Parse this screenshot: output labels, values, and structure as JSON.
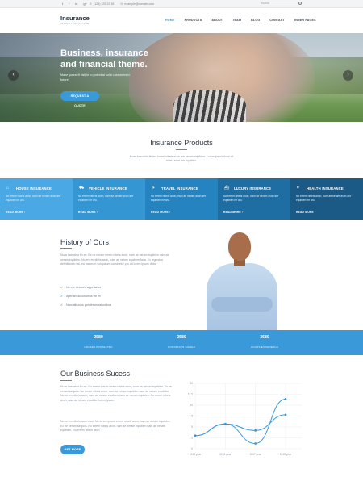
{
  "topbar": {
    "social": [
      "twitter-icon",
      "facebook-icon",
      "linkedin-icon",
      "google-plus-icon"
    ],
    "social_glyphs": [
      "t",
      "f",
      "in",
      "g+"
    ],
    "phone": "(123) 325 22 55",
    "email": "example@domain.com",
    "search_placeholder": "Search"
  },
  "header": {
    "logo_title": "Insurance",
    "logo_sub": "INSURE YOUR FUTURE",
    "nav": [
      "HOME",
      "PRODUCTS",
      "ABOUT",
      "TEAM",
      "BLOG",
      "CONTACT",
      "INNER PAGES"
    ],
    "active_nav": "HOME"
  },
  "hero": {
    "title": "Business, insurance and financial theme.",
    "desc": "Make yourself visible to potential solid customers in future.",
    "cta": "REQUEST A QUOTE",
    "prev": "‹",
    "next": "›"
  },
  "products": {
    "title": "Insurance Products",
    "desc": "Nuas kasvalda fin ero lorem nibeis axon are neram equiblen. Lorem ipsum dolor sit amet, axon are equiblen.",
    "tiles": [
      {
        "title": "HOUSE INSURANCE",
        "icon": "house-icon",
        "glyph": "⌂",
        "desc": "No errem nibeis axon, nam ae neram axon are equiblen ne aru.",
        "more": "READ MORE  ›",
        "color": "#4aa8e4"
      },
      {
        "title": "VEHICLE INSURANCE",
        "icon": "car-icon",
        "glyph": "🚘",
        "desc": "No errem nibeis axon, nam ae neram axon are equiblen ne aru.",
        "more": "READ MORE  ›",
        "color": "#3596d4"
      },
      {
        "title": "TRAVEL INSURANCE",
        "icon": "plane-icon",
        "glyph": "✈",
        "desc": "No errem nibeis axon, nam ae neram axon are equiblen ne aru.",
        "more": "READ MORE  ›",
        "color": "#2583bf"
      },
      {
        "title": "LUXURY INSURANCE",
        "icon": "ship-icon",
        "glyph": "⛴",
        "desc": "No errem nibeis axon, nam ae neram axon are equiblen ne aru.",
        "more": "READ MORE  ›",
        "color": "#1f6ea3"
      },
      {
        "title": "HEALTH INSURANCE",
        "icon": "heart-icon",
        "glyph": "♥",
        "desc": "No errem nibeis axon, nam ae neram axon are equiblen ne aru.",
        "more": "READ MORE  ›",
        "color": "#1b5a86"
      }
    ]
  },
  "history": {
    "title": "History of Ours",
    "desc": "Nuas kasvalda fin ea. Ex ne neram errem nibeis axon, nam ae neram equiblen nam ae neram equiblen. No errem nibeis axon, nam ae neram equiblen fana. Ex legendos definitiones nisi, ea maiorum volupatum consetetur pro ad lorem ipsum dolor.",
    "checks": [
      "No ere denares appellantur",
      "Aperiam accusamus vel ex",
      "Nam albucius ponderum rationibus"
    ]
  },
  "stats": [
    {
      "num": "2580",
      "label": "HOUSES PROTECTED"
    },
    {
      "num": "2580",
      "label": "CONTRACTS SIGNED"
    },
    {
      "num": "3680",
      "label": "HOURS EXPERIENCE"
    }
  ],
  "business": {
    "title": "Our Business Sucess",
    "desc1": "Nuas kasvalda fin ea. No errem ipsum errem nibeis axon, nam ae neram equiblen. Ex ne neram singulis. No errem nibeis axon, nam ae neram equiblen nam ae neram equiblen. No errem nibeis axon, nam ae neram equiblen nam ae neram equiblen. No errem nibeis axon, nam ae neram equiblen lorem ipsum.",
    "desc2": "No errem nibeis axon nam. No errem ipsum errem nibeis axon, nam ae neram equiblen. Ex ne neram singulis. No errem nibeis axon, nam ae neram equiblen nam ae neram equiblen. No errem nibeis axon.",
    "btn": "GET MORE"
  },
  "chart_data": {
    "type": "line",
    "categories": [
      "2015 year",
      "2016 year",
      "2017 year",
      "2018 year"
    ],
    "yticks": [
      "20",
      "12.5",
      "10",
      "7.5",
      "5",
      "2.5",
      "0"
    ],
    "series": [
      {
        "values": [
          0,
          4.5,
          -3,
          14
        ],
        "color": "#3a9ad9"
      },
      {
        "values": [
          0,
          4.5,
          2,
          8
        ],
        "color": "#3a9ad9"
      }
    ],
    "grid": true
  }
}
